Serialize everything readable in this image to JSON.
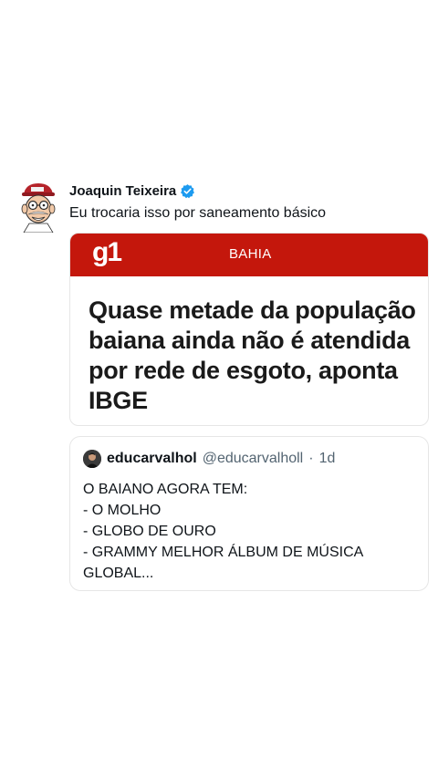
{
  "post": {
    "author": "Joaquin Teixeira",
    "text": "Eu trocaria isso por saneamento básico",
    "verified_icon": "verified-badge-icon",
    "avatar_icon": "caricature-avatar"
  },
  "news_card": {
    "logo": "g1",
    "section": "BAHIA",
    "headline": "Quase metade da população baiana ainda não é atendida por rede de esgoto, aponta IBGE",
    "banner_color": "#c4170c"
  },
  "quote": {
    "name": "educarvalhol",
    "handle": "@educarvalholl",
    "separator": "·",
    "time": "1d",
    "lines": [
      "O BAIANO AGORA TEM:",
      "- O MOLHO",
      "- GLOBO DE OURO",
      "- GRAMMY MELHOR ÁLBUM DE MÚSICA",
      "GLOBAL..."
    ]
  },
  "colors": {
    "verified_blue": "#1d9bf0",
    "text": "#0f1419",
    "secondary_text": "#536471"
  }
}
